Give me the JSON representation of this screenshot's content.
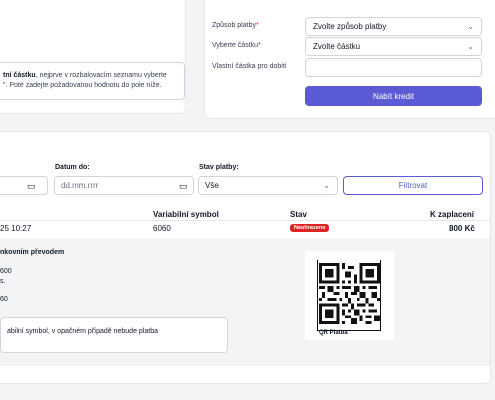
{
  "payment_info": {
    "line1_bold": "tní částku",
    "line1_rest": ", nejprve v rozbalovacím seznamu vyberte",
    "line2": "\". Poté zadejte požadovanou hodnotu do pole níže."
  },
  "credit_form": {
    "payment_method_label": "Způsob platby",
    "payment_method_value": "Zvolte způsob platby",
    "amount_label": "Vyberte částku",
    "amount_value": "Zvolte částku",
    "custom_amount_label": "Vlastní částka pro dobití",
    "custom_amount_value": "",
    "required_mark": "*",
    "submit_label": "Nabít kredit"
  },
  "filters": {
    "date_to_label": "Datum do:",
    "date_to_placeholder": "dd.mm.rrrr",
    "status_label": "Stav platby:",
    "status_value": "Vše",
    "filter_button": "Filtrovat"
  },
  "table": {
    "headers": {
      "variable_symbol": "Variabilní symbol",
      "status": "Stav",
      "to_pay": "K zaplacení"
    },
    "row": {
      "date": "25 10:27",
      "variable_symbol": "6060",
      "status": "Neuhrazeno",
      "to_pay": "800 Kč"
    },
    "status_color": "#dc2626"
  },
  "detail": {
    "method_title": "nkovním převodem",
    "line_amount": "600",
    "line_s": "s.",
    "line_symbol": "60",
    "note": "abilní symbol, v opačném případě nebude platba",
    "qr_label": "QR Platba"
  },
  "colors": {
    "accent": "#5b5bd6",
    "danger": "#dc2626"
  }
}
